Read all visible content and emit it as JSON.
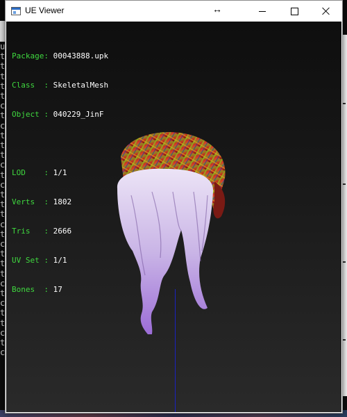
{
  "window": {
    "title": "UE Viewer",
    "cursor_glyph": "↔"
  },
  "info": {
    "rows": [
      {
        "label": "Package: ",
        "value": "00043888.upk"
      },
      {
        "label": "Class  : ",
        "value": "SkeletalMesh"
      },
      {
        "label": "Object : ",
        "value": "040229_JinF"
      },
      {
        "label": "LOD    : ",
        "value": "1/1"
      },
      {
        "label": "Verts  : ",
        "value": "1802"
      },
      {
        "label": "Tris   : ",
        "value": "2666"
      },
      {
        "label": "UV Set : ",
        "value": "1/1"
      },
      {
        "label": "Bones  : ",
        "value": "17"
      }
    ]
  },
  "background_console": {
    "left_column": "u\nt\nt\nt\nt\nt\nc\nt\nc\nt\nt\nt\nc\nt\nc\nt\nt\nt\nc\nt\nc\nt\nt\nt\nc\nt\nc\nt\nt\nc\nt\nc"
  },
  "colors": {
    "label_green": "#3fd83f",
    "value_white": "#ffffff",
    "axis_blue": "#1a22c0"
  }
}
